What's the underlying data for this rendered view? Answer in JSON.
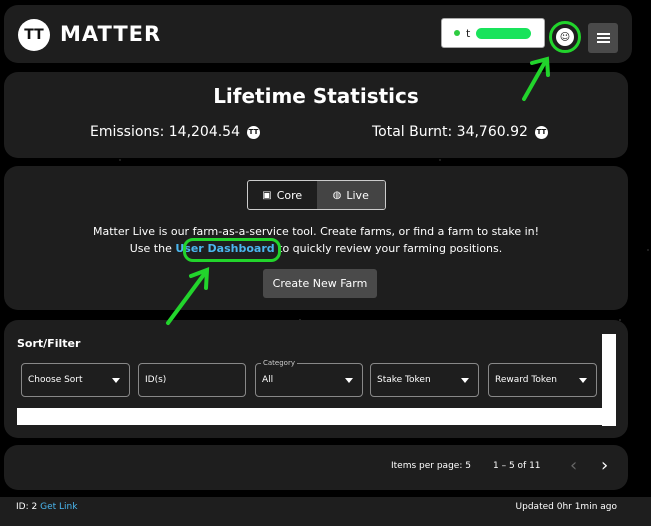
{
  "header": {
    "logo_mark": "TT",
    "brand": "MATTER",
    "wallet_prefix": "t",
    "avatar_glyph": "☺"
  },
  "stats": {
    "title": "Lifetime Statistics",
    "emissions_label": "Emissions: 14,204.54",
    "burnt_label": "Total Burnt: 34,760.92",
    "coin_glyph": "TT"
  },
  "main": {
    "tabs": [
      {
        "label": "Core",
        "icon": "square-icon",
        "glyph": "▣"
      },
      {
        "label": "Live",
        "icon": "globe-icon",
        "glyph": "◍"
      }
    ],
    "desc_line1": "Matter Live is our farm-as-a-service tool. Create farms, or find a farm to stake in!",
    "desc_prefix": "Use the ",
    "desc_link": "User Dashboard",
    "desc_suffix": " to quickly review your farming positions.",
    "create_label": "Create New Farm"
  },
  "filter": {
    "title": "Sort/Filter",
    "sort_label": "Choose Sort",
    "ids_label": "ID(s)",
    "category_legend": "Category",
    "category_value": "All",
    "stake_label": "Stake Token",
    "reward_label": "Reward Token"
  },
  "pager": {
    "items_per_page": "Items per page:  5",
    "range": "1 – 5 of 11",
    "prev": "‹",
    "next": "›"
  },
  "footer": {
    "id_label": "ID: 2",
    "get_link": "Get Link",
    "updated": "Updated 0hr 1min ago"
  },
  "colors": {
    "highlight": "#22d42c",
    "link": "#4ab6ee",
    "panel": "#1e1e1e"
  }
}
